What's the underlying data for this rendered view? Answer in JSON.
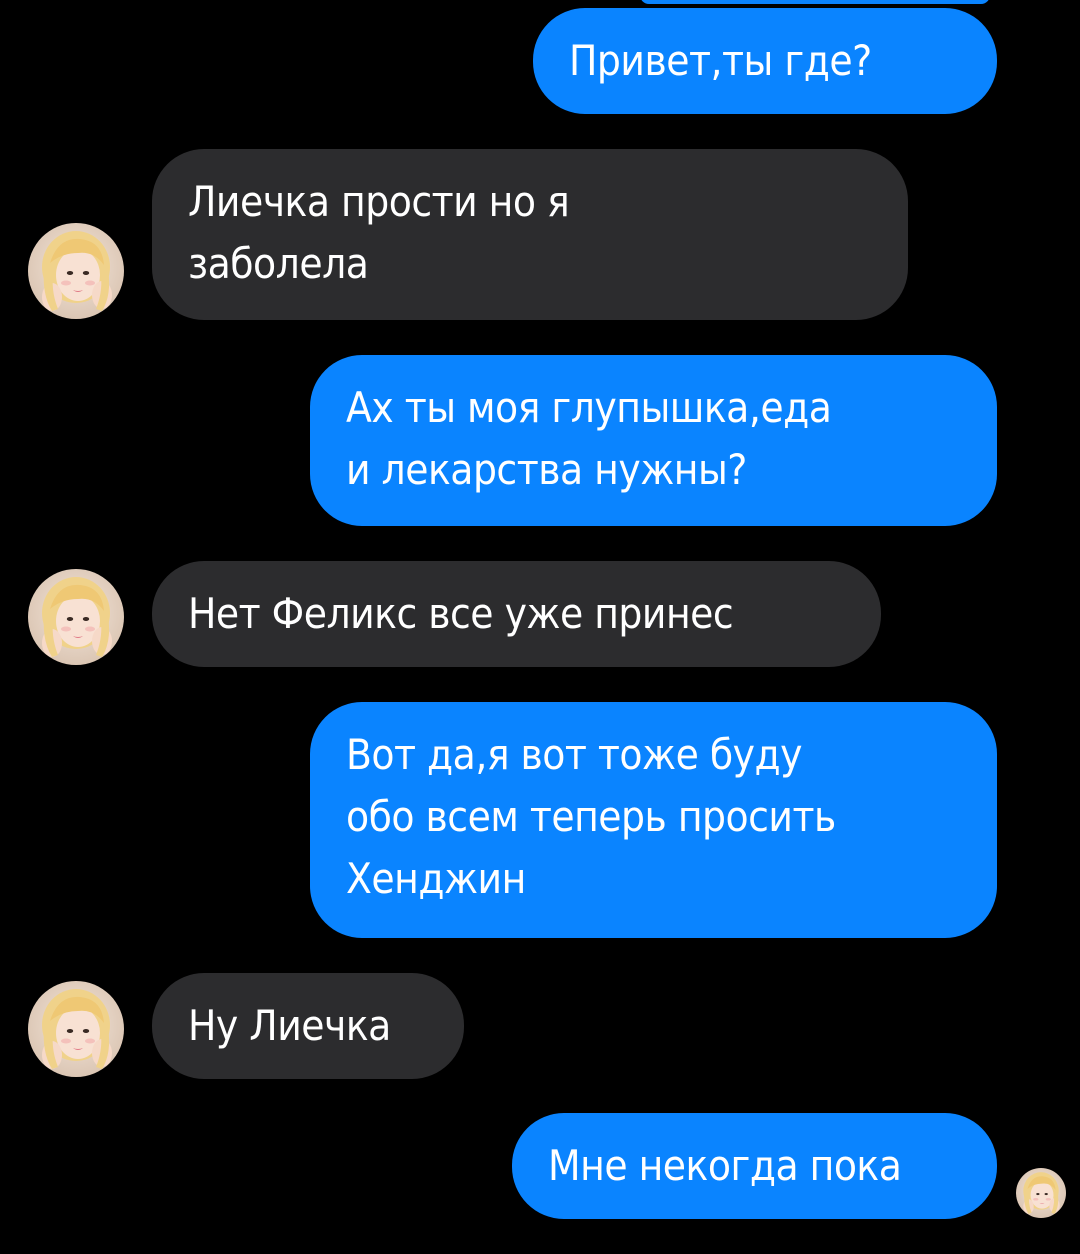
{
  "conversation": {
    "messages": [
      {
        "direction": "outgoing",
        "text": "Привет,ты где?"
      },
      {
        "direction": "incoming",
        "text": "Лиечка прости но я\nзаболела"
      },
      {
        "direction": "outgoing",
        "text": "Ах ты моя глупышка,еда\nи лекарства нужны?"
      },
      {
        "direction": "incoming",
        "text": "Нет Феликс все уже принес"
      },
      {
        "direction": "outgoing",
        "text": "Вот да,я вот тоже буду\nобо всем теперь просить\nХенджин"
      },
      {
        "direction": "incoming",
        "text": "Ну Лиечка"
      },
      {
        "direction": "outgoing",
        "text": "Мне некогда пока"
      }
    ]
  },
  "colors": {
    "background": "#000000",
    "outgoing_bubble": "#0a84ff",
    "incoming_bubble": "#2c2c2e",
    "message_text": "#ffffff"
  },
  "icons": {
    "contact_avatar": "contact-avatar-icon",
    "read_receipt": "read-receipt-avatar-icon"
  }
}
